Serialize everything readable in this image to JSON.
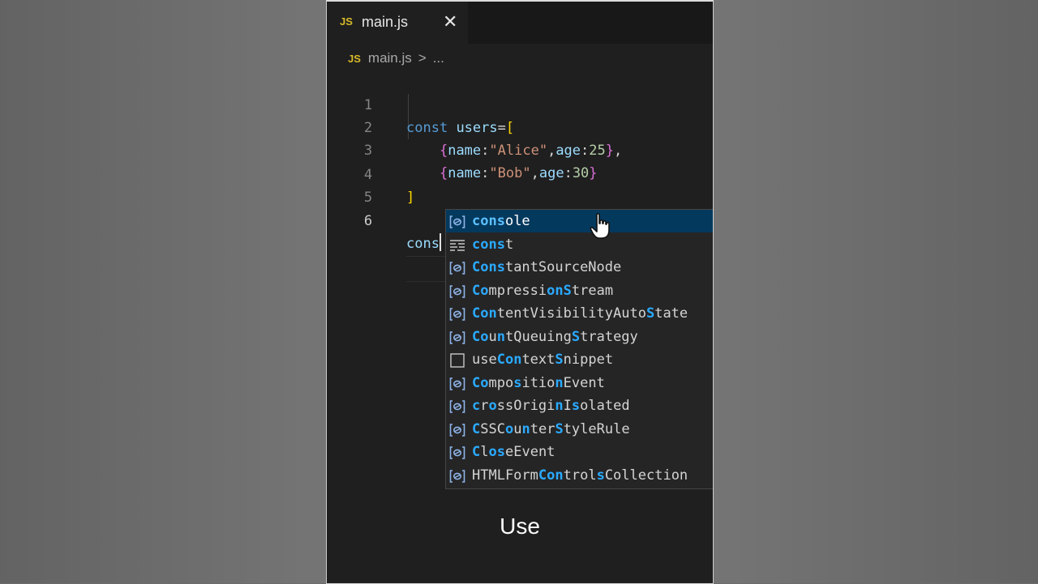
{
  "tab": {
    "icon": "js-file-icon",
    "badge": "JS",
    "label": "main.js",
    "close": "✕"
  },
  "breadcrumb": {
    "badge": "JS",
    "file": "main.js",
    "separator": ">",
    "more": "..."
  },
  "editor": {
    "line_numbers": [
      "1",
      "2",
      "3",
      "4",
      "5",
      "6"
    ],
    "line1": {
      "kw": "const",
      "name": "users",
      "op": "=",
      "open": "["
    },
    "line2": {
      "open": "{",
      "k1": "name",
      "colon1": ":",
      "v1": "\"Alice\"",
      "comma1": ",",
      "k2": "age",
      "colon2": ":",
      "v2": "25",
      "close": "}",
      "trail": ","
    },
    "line3": {
      "open": "{",
      "k1": "name",
      "colon1": ":",
      "v1": "\"Bob\"",
      "comma1": ",",
      "k2": "age",
      "colon2": ":",
      "v2": "30",
      "close": "}"
    },
    "line4": {
      "close": "]"
    },
    "line6": {
      "typed": "cons"
    }
  },
  "suggestions": [
    {
      "kind": "variable-icon",
      "segments": [
        [
          "cons",
          true
        ],
        [
          "ole",
          false
        ]
      ],
      "selected": true
    },
    {
      "kind": "snippet-icon",
      "segments": [
        [
          "cons",
          true
        ],
        [
          "t",
          false
        ]
      ]
    },
    {
      "kind": "variable-icon",
      "segments": [
        [
          "Cons",
          true
        ],
        [
          "tantSourceNode",
          false
        ]
      ]
    },
    {
      "kind": "variable-icon",
      "segments": [
        [
          "Co",
          true
        ],
        [
          "mpressi",
          false
        ],
        [
          "on",
          true
        ],
        [
          "S",
          true
        ],
        [
          "tream",
          false
        ]
      ]
    },
    {
      "kind": "variable-icon",
      "segments": [
        [
          "Con",
          true
        ],
        [
          "tentVisibilityAuto",
          false
        ],
        [
          "S",
          true
        ],
        [
          "tate",
          false
        ]
      ]
    },
    {
      "kind": "variable-icon",
      "segments": [
        [
          "Co",
          true
        ],
        [
          "u",
          false
        ],
        [
          "n",
          true
        ],
        [
          "tQueuing",
          false
        ],
        [
          "S",
          true
        ],
        [
          "trategy",
          false
        ]
      ]
    },
    {
      "kind": "text-icon",
      "segments": [
        [
          "use",
          false
        ],
        [
          "Con",
          true
        ],
        [
          "text",
          false
        ],
        [
          "S",
          true
        ],
        [
          "nippet",
          false
        ]
      ]
    },
    {
      "kind": "variable-icon",
      "segments": [
        [
          "Co",
          true
        ],
        [
          "mpo",
          false
        ],
        [
          "s",
          true
        ],
        [
          "itio",
          false
        ],
        [
          "n",
          true
        ],
        [
          "Event",
          false
        ]
      ]
    },
    {
      "kind": "variable-icon",
      "segments": [
        [
          "c",
          true
        ],
        [
          "r",
          false
        ],
        [
          "o",
          true
        ],
        [
          "ssOrigi",
          false
        ],
        [
          "n",
          true
        ],
        [
          "I",
          false
        ],
        [
          "s",
          true
        ],
        [
          "olated",
          false
        ]
      ]
    },
    {
      "kind": "variable-icon",
      "segments": [
        [
          "C",
          true
        ],
        [
          "SSC",
          false
        ],
        [
          "o",
          true
        ],
        [
          "u",
          false
        ],
        [
          "n",
          true
        ],
        [
          "ter",
          false
        ],
        [
          "S",
          true
        ],
        [
          "tyleRule",
          false
        ]
      ]
    },
    {
      "kind": "variable-icon",
      "segments": [
        [
          "C",
          true
        ],
        [
          "l",
          false
        ],
        [
          "o",
          true
        ],
        [
          "s",
          true
        ],
        [
          "eEvent",
          false
        ]
      ]
    },
    {
      "kind": "variable-icon",
      "segments": [
        [
          "HTMLForm",
          false
        ],
        [
          "Con",
          true
        ],
        [
          "trol",
          false
        ],
        [
          "s",
          true
        ],
        [
          "Collection",
          false
        ]
      ]
    }
  ],
  "cursor": {
    "icon": "hand-pointer-icon"
  },
  "subtitle": "Use",
  "colors": {
    "keyword": "#569cd6",
    "variable": "#9cdcfe",
    "string": "#ce9178",
    "number": "#b5cea8",
    "match": "#2aaaff",
    "selected_bg": "#04395e"
  }
}
